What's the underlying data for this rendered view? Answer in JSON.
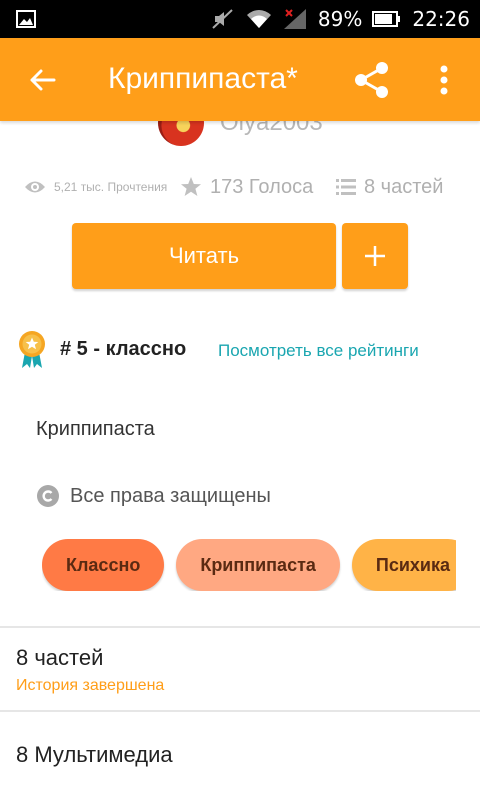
{
  "status_bar": {
    "battery_percent": "89%",
    "time": "22:26"
  },
  "appbar": {
    "title": "Криппипаста*",
    "back_icon": "arrow-left-icon",
    "share_icon": "share-icon",
    "more_icon": "more-vert-icon"
  },
  "author": {
    "name": "Olya2003"
  },
  "stats": {
    "reads": "5,21 тыс. Прочтения",
    "votes": "173 Голоса",
    "parts": "8 частей"
  },
  "actions": {
    "read_label": "Читать",
    "add_label": "+"
  },
  "ranking": {
    "text": "# 5 - классно",
    "link": "Посмотреть все рейтинги"
  },
  "description": "Криппипаста",
  "copyright": "Все права защищены",
  "tags": [
    {
      "label": "Классно",
      "color": "#ff7a45"
    },
    {
      "label": "Криппипаста",
      "color": "#ffa882"
    },
    {
      "label": "Психика",
      "color": "#ffb347"
    }
  ],
  "parts_section": {
    "title": "8 частей",
    "status": "История завершена"
  },
  "media_section": {
    "title": "8 Мультимедиа"
  },
  "colors": {
    "accent": "#ff9e19",
    "link": "#1aa6b0"
  }
}
